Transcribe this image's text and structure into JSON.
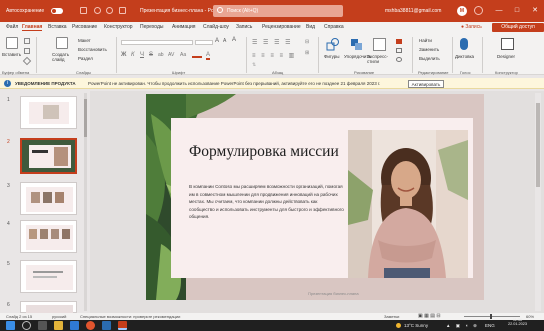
{
  "titlebar": {
    "autosave_label": "Автосохранение",
    "toggle_state": "Вкл",
    "document_title": "Презентация бизнес-плана - PowerPoint",
    "search_placeholder": "Поиск (Alt+Q)",
    "user_email": "mshba38811@gmail.com",
    "avatar_letter": "M",
    "minimize": "—",
    "maximize": "□",
    "close": "✕"
  },
  "menu": {
    "tabs": [
      "Файл",
      "Главная",
      "Вставка",
      "Рисование",
      "Конструктор",
      "Переходы",
      "Анимация",
      "Слайд-шоу",
      "Запись",
      "Рецензирование",
      "Вид",
      "Справка"
    ],
    "record_label": "● Запись",
    "share_label": "Общий доступ"
  },
  "ribbon": {
    "paste": "Вставить",
    "create_slide": "Создать слайд",
    "layout": "Макет",
    "reset": "Восстановить",
    "section": "Раздел",
    "shapes": "Фигуры",
    "arrange": "Упорядочить",
    "quick_styles": "Экспресс-стили",
    "find": "Найти",
    "replace": "Заменить",
    "select": "Выделить",
    "dictation": "Диктовка",
    "designer": "Designer",
    "font_name": "",
    "font_size": "",
    "group_labels": [
      "Буфер обмена",
      "Слайды",
      "Шрифт",
      "Абзац",
      "Рисование",
      "Редактирование",
      "Голос",
      "Конструктор"
    ]
  },
  "notification": {
    "title": "УВЕДОМЛЕНИЕ ПРОДУКТА",
    "text": "PowerPoint не активирован. Чтобы продолжить использование PowerPoint без прерываний, активируйте его не позднее 21 февраля 2023 г.",
    "button": "Активировать"
  },
  "thumbnails": {
    "numbers": [
      "1",
      "2",
      "3",
      "4",
      "5",
      "6"
    ]
  },
  "slide": {
    "title": "Формулировка миссии",
    "body": "В компании Contoso мы расширяем возможности организаций, помогая им в совместном мышлении для продвижения инноваций на рабочих местах. Мы считаем, что компании должны действовать как сообщество и использовать инструменты для быстрого и эффективного общения.",
    "footer": "Презентация бизнес-плана"
  },
  "status": {
    "slide_counter": "Слайд 2 из 15",
    "language": "русский",
    "accessibility": "Специальные возможности: проверьте рекомендации",
    "notes": "Заметки",
    "zoom": "60%"
  },
  "taskbar": {
    "weather": "13°C  Sunny",
    "lang": "ENG",
    "time": "11:36",
    "date": "22.01.2023"
  },
  "colors": {
    "accent": "#c43e1c",
    "slide_bg": "#f3e9ea"
  }
}
